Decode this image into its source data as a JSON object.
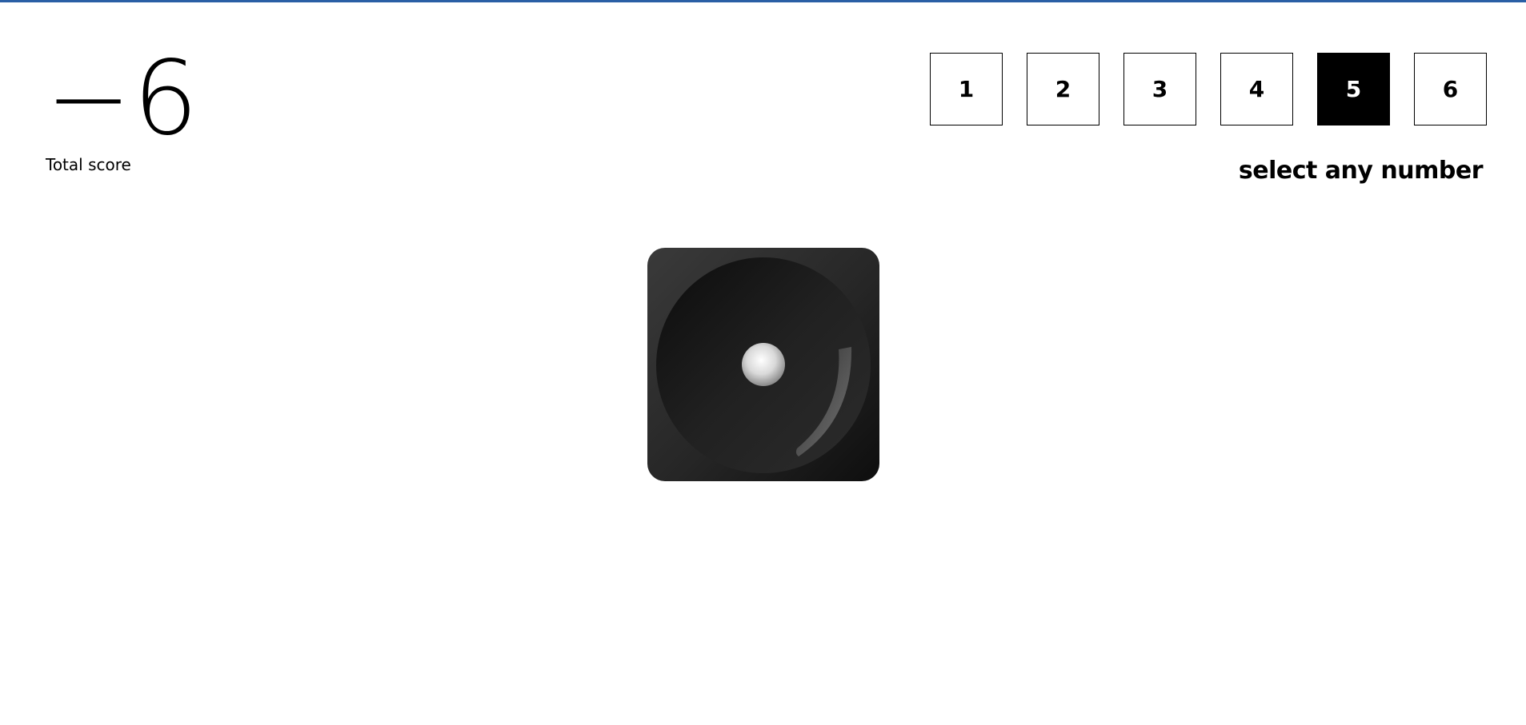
{
  "header": {
    "accent_color": "#2a5fa5"
  },
  "score": {
    "value": "−6",
    "label": "Total score"
  },
  "number_selector": {
    "numbers": [
      "1",
      "2",
      "3",
      "4",
      "5",
      "6"
    ],
    "selected": "5",
    "prompt": "select any number"
  },
  "die": {
    "face_value": 1,
    "icon": "die-face-one-icon"
  }
}
